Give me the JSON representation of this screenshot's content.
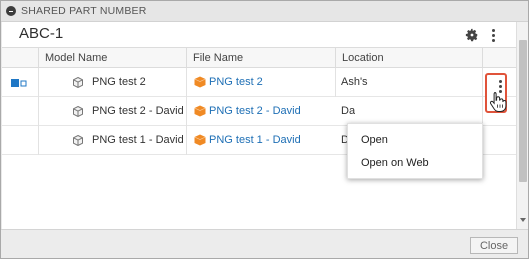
{
  "dialog": {
    "title": "SHARED PART NUMBER",
    "part_number": "ABC-1",
    "close_label": "Close"
  },
  "table": {
    "columns": [
      "Model Name",
      "File Name",
      "Location"
    ],
    "rows": [
      {
        "model": "PNG test 2",
        "file": "PNG test 2",
        "location": "Ash's"
      },
      {
        "model": "PNG test 2 - David",
        "file": "PNG test 2 - David",
        "location": "Da"
      },
      {
        "model": "PNG test 1 - David",
        "file": "PNG test 1 - David",
        "location": "Da"
      }
    ]
  },
  "context_menu": {
    "items": [
      "Open",
      "Open on Web"
    ]
  },
  "icons": {
    "dialog": "collapse-icon",
    "settings": "gear-icon",
    "more": "more-vertical-icon",
    "model": "component-cube-icon",
    "file": "design-file-icon",
    "cursor": "hand-pointer-icon"
  },
  "colors": {
    "link": "#1e6fb5",
    "highlight_border": "#e0533a",
    "file_icon": "#f08a24",
    "selection_indicator": "#1f77c5"
  }
}
